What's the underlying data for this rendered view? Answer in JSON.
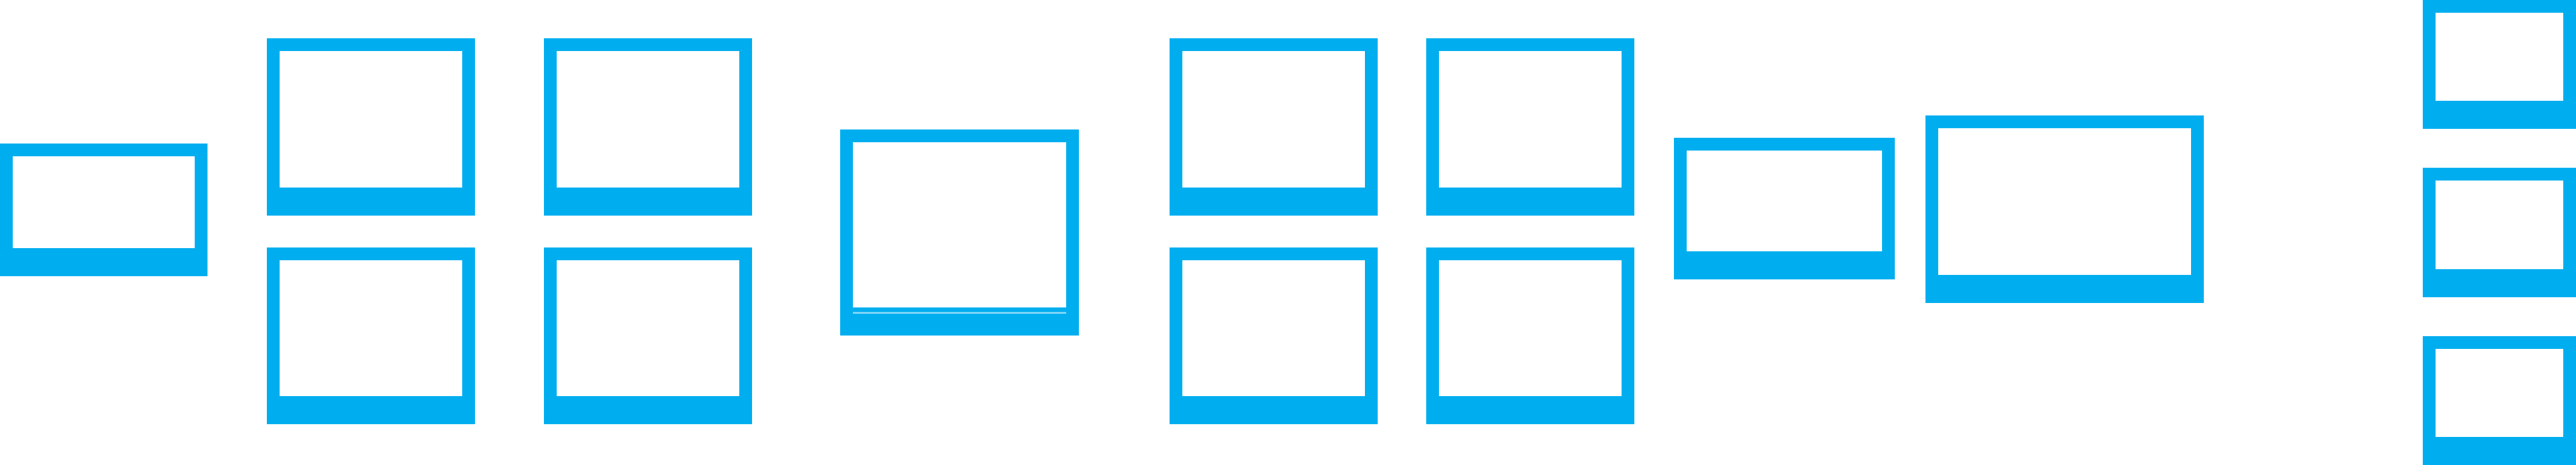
{
  "colors": {
    "frame_stroke": "#00aeef",
    "frame_fill": "#ffffff",
    "background": "#ffffff"
  },
  "diagram": {
    "groups": [
      {
        "name": "single-left",
        "frames": 1
      },
      {
        "name": "stack-a",
        "frames": 2
      },
      {
        "name": "stack-b",
        "frames": 2
      },
      {
        "name": "single-center",
        "frames": 1
      },
      {
        "name": "stack-c",
        "frames": 2
      },
      {
        "name": "stack-d",
        "frames": 2
      },
      {
        "name": "single-medium",
        "frames": 1
      },
      {
        "name": "single-large",
        "frames": 1
      },
      {
        "name": "column-right",
        "frames": 3
      }
    ]
  }
}
